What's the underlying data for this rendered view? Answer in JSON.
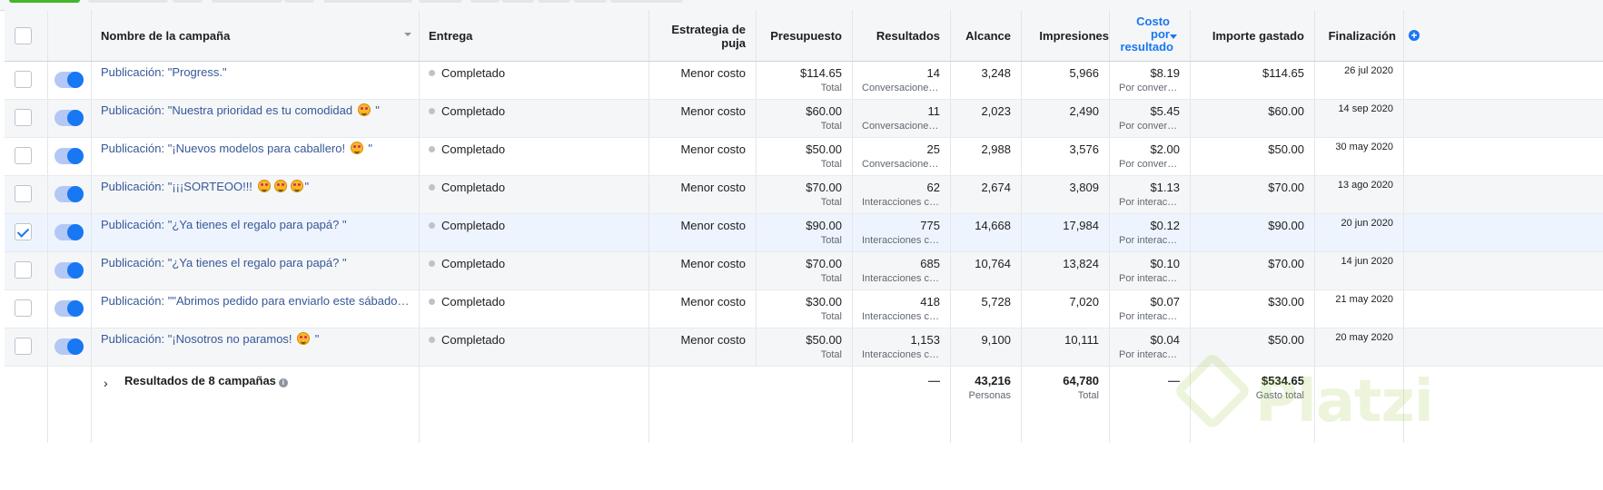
{
  "table": {
    "headers": {
      "name": "Nombre de la campaña",
      "entrega": "Entrega",
      "estrategia_line1": "Estrategia de",
      "estrategia_line2": "puja",
      "presupuesto": "Presupuesto",
      "resultados": "Resultados",
      "alcance": "Alcance",
      "impresiones": "Impresiones",
      "costo_line1": "Costo",
      "costo_line2": "por",
      "costo_line3": "resultado",
      "importe": "Importe gastado",
      "finalizacion": "Finalización"
    },
    "rows": [
      {
        "name": "Publicación: \"Progress.\"",
        "emojis": 0,
        "entrega": "Completado",
        "estrategia": "Menor costo",
        "presupuesto": "$114.65",
        "presupuesto_sub": "Total",
        "resultados": "14",
        "resultados_sub": "Conversaciones con mensajes iniciadas",
        "alcance": "3,248",
        "impresiones": "5,966",
        "costo": "$8.19",
        "costo_sub": "Por conversación con mensajes iniciada",
        "importe": "$114.65",
        "fin": "26 jul 2020",
        "checked": false
      },
      {
        "name": "Publicación: \"Nuestra prioridad es tu comodidad ",
        "name_end": " \"",
        "emojis": 1,
        "entrega": "Completado",
        "estrategia": "Menor costo",
        "presupuesto": "$60.00",
        "presupuesto_sub": "Total",
        "resultados": "11",
        "resultados_sub": "Conversaciones con mensajes iniciadas",
        "alcance": "2,023",
        "impresiones": "2,490",
        "costo": "$5.45",
        "costo_sub": "Por conversación con mensajes iniciada",
        "importe": "$60.00",
        "fin": "14 sep 2020",
        "checked": false
      },
      {
        "name": "Publicación: \"¡Nuevos modelos para caballero! ",
        "name_end": " \"",
        "emojis": 1,
        "entrega": "Completado",
        "estrategia": "Menor costo",
        "presupuesto": "$50.00",
        "presupuesto_sub": "Total",
        "resultados": "25",
        "resultados_sub": "Conversaciones con mensajes iniciadas",
        "alcance": "2,988",
        "impresiones": "3,576",
        "costo": "$2.00",
        "costo_sub": "Por conversación con mensajes iniciada",
        "importe": "$50.00",
        "fin": "30 may 2020",
        "checked": false
      },
      {
        "name": "Publicación: \"¡¡¡SORTEOO!!! ",
        "name_end": "\"",
        "emojis": 3,
        "entrega": "Completado",
        "estrategia": "Menor costo",
        "presupuesto": "$70.00",
        "presupuesto_sub": "Total",
        "resultados": "62",
        "resultados_sub": "Interacciones con la publicación",
        "alcance": "2,674",
        "impresiones": "3,809",
        "costo": "$1.13",
        "costo_sub": "Por interacción con la publicación",
        "importe": "$70.00",
        "fin": "13 ago 2020",
        "checked": false
      },
      {
        "name": "Publicación: \"¿Ya tienes el regalo para papá? \"",
        "emojis": 0,
        "entrega": "Completado",
        "estrategia": "Menor costo",
        "presupuesto": "$90.00",
        "presupuesto_sub": "Total",
        "resultados": "775",
        "resultados_sub": "Interacciones con la publicación",
        "alcance": "14,668",
        "impresiones": "17,984",
        "costo": "$0.12",
        "costo_sub": "Por interacción con la publicación",
        "importe": "$90.00",
        "fin": "20 jun 2020",
        "checked": true
      },
      {
        "name": "Publicación: \"¿Ya tienes el regalo para papá? \"",
        "emojis": 0,
        "entrega": "Completado",
        "estrategia": "Menor costo",
        "presupuesto": "$70.00",
        "presupuesto_sub": "Total",
        "resultados": "685",
        "resultados_sub": "Interacciones con la publicación",
        "alcance": "10,764",
        "impresiones": "13,824",
        "costo": "$0.10",
        "costo_sub": "Por interacción con la publicación",
        "importe": "$70.00",
        "fin": "14 jun 2020",
        "checked": false
      },
      {
        "name": "Publicación: \"\"Abrimos pedido para enviarlo este sábado ...",
        "emojis": 0,
        "entrega": "Completado",
        "estrategia": "Menor costo",
        "presupuesto": "$30.00",
        "presupuesto_sub": "Total",
        "resultados": "418",
        "resultados_sub": "Interacciones con la publicación",
        "alcance": "5,728",
        "impresiones": "7,020",
        "costo": "$0.07",
        "costo_sub": "Por interacción con la publicación",
        "importe": "$30.00",
        "fin": "21 may 2020",
        "checked": false
      },
      {
        "name": "Publicación: \"¡Nosotros no paramos! ",
        "name_end": " \"",
        "emojis": 1,
        "entrega": "Completado",
        "estrategia": "Menor costo",
        "presupuesto": "$50.00",
        "presupuesto_sub": "Total",
        "resultados": "1,153",
        "resultados_sub": "Interacciones con la publicación",
        "alcance": "9,100",
        "impresiones": "10,111",
        "costo": "$0.04",
        "costo_sub": "Por interacción con la publicación",
        "importe": "$50.00",
        "fin": "20 may 2020",
        "checked": false
      }
    ],
    "totals": {
      "label": "Resultados de 8 campañas",
      "resultados": "—",
      "alcance": "43,216",
      "alcance_sub": "Personas",
      "impresiones": "64,780",
      "impresiones_sub": "Total",
      "costo": "—",
      "importe": "$534.65",
      "importe_sub": "Gasto total"
    }
  },
  "icons": {
    "expand": "chevron-right-icon",
    "info": "info-icon",
    "add_column": "plus-circle-icon",
    "emoji": "heart-eyes-emoji-icon"
  },
  "colors": {
    "link": "#365899",
    "accent": "#1877f2",
    "toggle_on": "#1877f2",
    "watermark": "#98ca3f"
  },
  "watermark": {
    "text": "Platzi"
  }
}
